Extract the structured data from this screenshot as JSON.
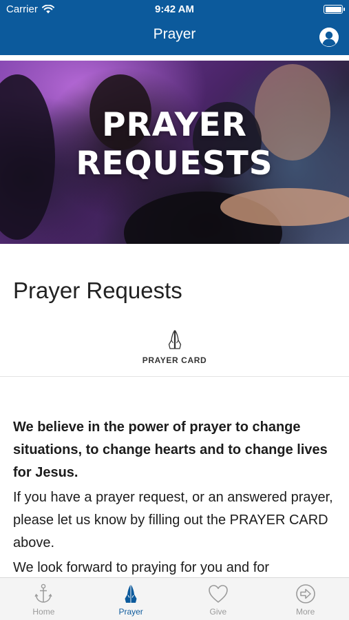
{
  "status_bar": {
    "carrier": "Carrier",
    "time": "9:42 AM"
  },
  "nav": {
    "title": "Prayer",
    "profile_icon": "profile-icon"
  },
  "banner": {
    "line1": "PRAYER",
    "line2": "REQUESTS"
  },
  "page": {
    "heading": "Prayer Requests",
    "prayer_card_label": "PRAYER CARD",
    "prayer_card_icon": "praying-hands-icon",
    "paragraph_bold": "We believe in the power of prayer to change situations, to change hearts and to change lives for Jesus.",
    "paragraph_1": "If you have a prayer request, or an answered prayer, please let us know by filling out the PRAYER CARD above.",
    "paragraph_2": "We look forward to praying for you and for"
  },
  "tabbar": {
    "items": [
      {
        "label": "Home",
        "icon": "anchor-icon"
      },
      {
        "label": "Prayer",
        "icon": "praying-hands-icon"
      },
      {
        "label": "Give",
        "icon": "heart-icon"
      },
      {
        "label": "More",
        "icon": "arrow-circle-icon"
      }
    ],
    "active_index": 1
  },
  "colors": {
    "brand": "#0c5a9c",
    "inactive": "#9a9a9a",
    "tabbar_bg": "#f4f4f4"
  }
}
